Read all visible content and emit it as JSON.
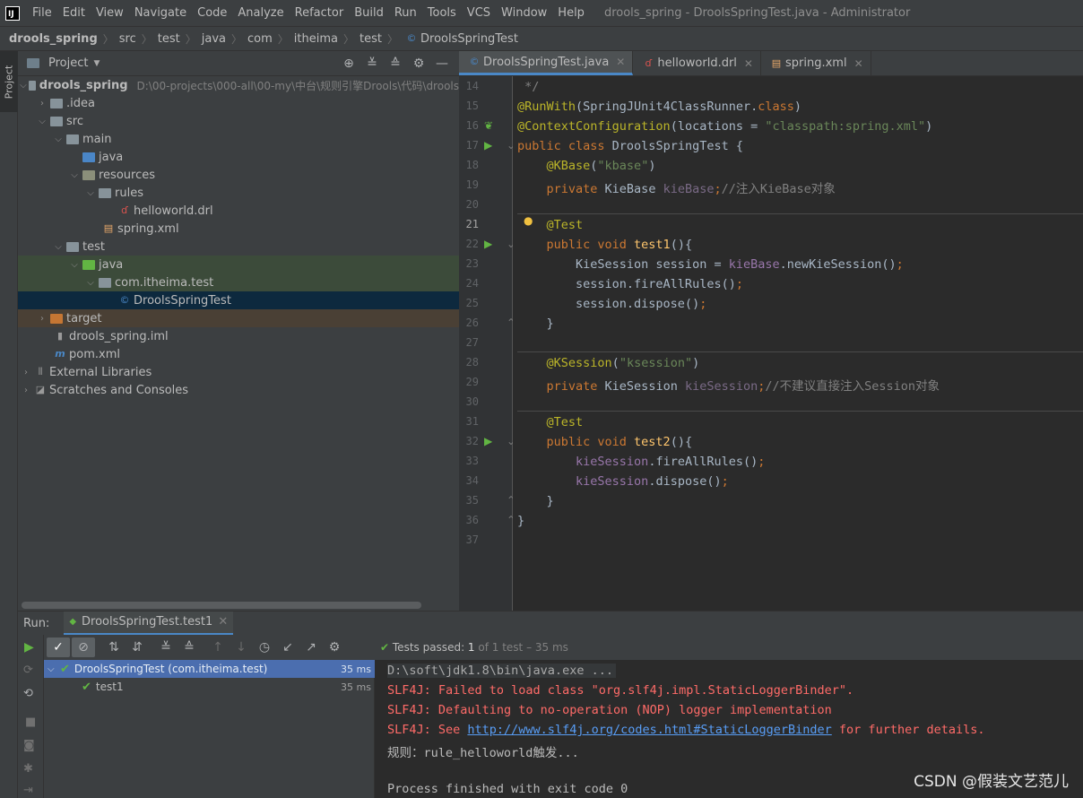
{
  "menubar": {
    "items": [
      "File",
      "Edit",
      "View",
      "Navigate",
      "Code",
      "Analyze",
      "Refactor",
      "Build",
      "Run",
      "Tools",
      "VCS",
      "Window",
      "Help"
    ],
    "window_title": "drools_spring - DroolsSpringTest.java - Administrator"
  },
  "breadcrumb": [
    "drools_spring",
    "src",
    "test",
    "java",
    "com",
    "itheima",
    "test",
    "DroolsSpringTest"
  ],
  "project_panel": {
    "title": "Project",
    "side_tab": "Project",
    "tree": [
      {
        "label": "drools_spring",
        "path": "D:\\00-projects\\000-all\\00-my\\中台\\规则引擎Drools\\代码\\drools"
      },
      {
        "label": ".idea"
      },
      {
        "label": "src"
      },
      {
        "label": "main"
      },
      {
        "label": "java"
      },
      {
        "label": "resources"
      },
      {
        "label": "rules"
      },
      {
        "label": "helloworld.drl"
      },
      {
        "label": "spring.xml"
      },
      {
        "label": "test"
      },
      {
        "label": "java"
      },
      {
        "label": "com.itheima.test"
      },
      {
        "label": "DroolsSpringTest"
      },
      {
        "label": "target"
      },
      {
        "label": "drools_spring.iml"
      },
      {
        "label": "pom.xml"
      },
      {
        "label": "External Libraries"
      },
      {
        "label": "Scratches and Consoles"
      }
    ]
  },
  "editor": {
    "tabs": [
      "DroolsSpringTest.java",
      "helloworld.drl",
      "spring.xml"
    ],
    "line_numbers": [
      "14",
      "15",
      "16",
      "17",
      "18",
      "19",
      "20",
      "21",
      "22",
      "23",
      "24",
      "25",
      "26",
      "27",
      "28",
      "29",
      "30",
      "31",
      "32",
      "33",
      "34",
      "35",
      "36",
      "37"
    ],
    "code": {
      "l14": " */",
      "l15a": "@RunWith",
      "l15b": "(SpringJUnit4ClassRunner.",
      "l15c": "class",
      "l15d": ")",
      "l16a": "@ContextConfiguration",
      "l16b": "(locations = ",
      "l16c": "\"classpath:spring.xml\"",
      "l16d": ")",
      "l17a": "public class ",
      "l17b": "DroolsSpringTest {",
      "l18a": "    @KBase",
      "l18b": "(",
      "l18c": "\"kbase\"",
      "l18d": ")",
      "l19a": "    private ",
      "l19b": "KieBase ",
      "l19c": "kieBase",
      "l19d": ";",
      "l19e": "//注入KieBase对象",
      "l21": "    @Test",
      "l22a": "    public void ",
      "l22b": "test1",
      "l22c": "(){",
      "l23a": "        KieSession session = ",
      "l23b": "kieBase",
      "l23c": ".newKieSession()",
      "l23d": ";",
      "l24a": "        session.fireAllRules()",
      "l24b": ";",
      "l25a": "        session.dispose()",
      "l25b": ";",
      "l26": "    }",
      "l28a": "    @KSession",
      "l28b": "(",
      "l28c": "\"ksession\"",
      "l28d": ")",
      "l29a": "    private ",
      "l29b": "KieSession ",
      "l29c": "kieSession",
      "l29d": ";",
      "l29e": "//不建议直接注入Session对象",
      "l31": "    @Test",
      "l32a": "    public void ",
      "l32b": "test2",
      "l32c": "(){",
      "l33a": "        kieSession",
      "l33b": ".fireAllRules()",
      "l33c": ";",
      "l34a": "        kieSession",
      "l34b": ".dispose()",
      "l34c": ";",
      "l35": "    }",
      "l36": "}"
    }
  },
  "run_panel": {
    "label": "Run:",
    "tab": "DroolsSpringTest.test1",
    "status_prefix": "Tests passed: ",
    "status_count": "1",
    "status_rest": " of 1 test – 35 ms",
    "tests": [
      {
        "name": "DroolsSpringTest (com.itheima.test)",
        "time": "35 ms"
      },
      {
        "name": "test1",
        "time": "35 ms"
      }
    ],
    "console": {
      "line1": "D:\\soft\\jdk1.8\\bin\\java.exe ...",
      "line2": "SLF4J: Failed to load class \"org.slf4j.impl.StaticLoggerBinder\".",
      "line3": "SLF4J: Defaulting to no-operation (NOP) logger implementation",
      "line4a": "SLF4J: See ",
      "line4link": "http://www.slf4j.org/codes.html#StaticLoggerBinder",
      "line4b": " for further details.",
      "line5": "规则：rule_helloworld触发...",
      "line7": "Process finished with exit code 0"
    }
  },
  "watermark": "CSDN @假装文艺范儿",
  "colors": {
    "accent": "#4a88c7",
    "pass_green": "#62b543",
    "error_red": "#ff6b68",
    "link": "#589df6"
  }
}
